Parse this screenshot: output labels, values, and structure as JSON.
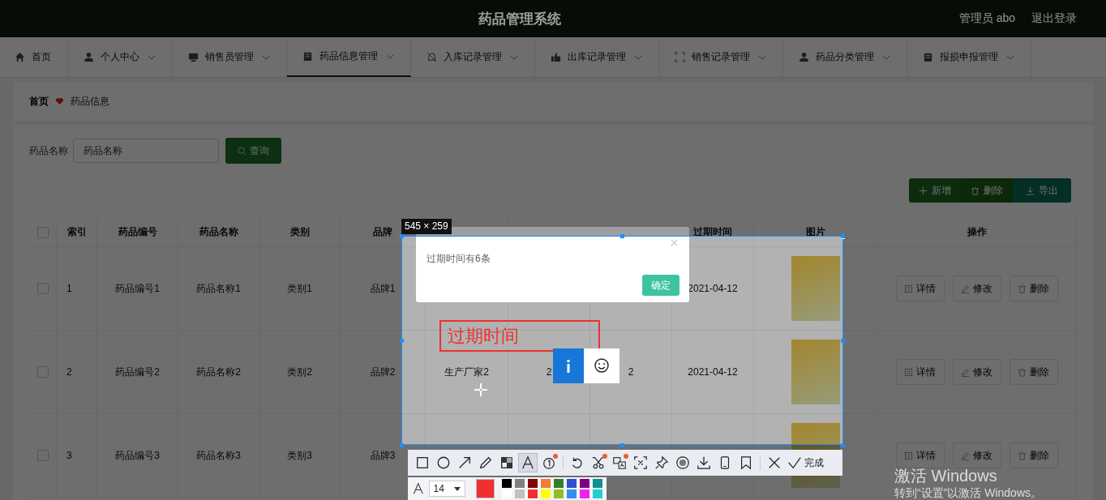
{
  "header": {
    "title": "药品管理系统",
    "user": "管理员 abo",
    "logout": "退出登录"
  },
  "nav": [
    {
      "label": "首页",
      "kind": "home",
      "dropdown": false,
      "selected": false
    },
    {
      "label": "个人中心",
      "kind": "user",
      "dropdown": true,
      "selected": false
    },
    {
      "label": "销售员管理",
      "kind": "monitor",
      "dropdown": true,
      "selected": false
    },
    {
      "label": "药品信息管理",
      "kind": "clipboard",
      "dropdown": true,
      "selected": true
    },
    {
      "label": "入库记录管理",
      "kind": "bell",
      "dropdown": true,
      "selected": false
    },
    {
      "label": "出库记录管理",
      "kind": "thumb",
      "dropdown": true,
      "selected": false
    },
    {
      "label": "销售记录管理",
      "kind": "frame",
      "dropdown": true,
      "selected": false
    },
    {
      "label": "药品分类管理",
      "kind": "user",
      "dropdown": true,
      "selected": false
    },
    {
      "label": "报损申报管理",
      "kind": "clipboard",
      "dropdown": true,
      "selected": false
    }
  ],
  "breadcrumb": {
    "home": "首页",
    "current": "药品信息"
  },
  "search": {
    "label": "药品名称",
    "placeholder": "药品名称",
    "button": "查询"
  },
  "actions": [
    {
      "label": "新增",
      "kind": "add"
    },
    {
      "label": "删除",
      "kind": "delete"
    },
    {
      "label": "导出",
      "kind": "export"
    }
  ],
  "table": {
    "header_checked": false,
    "columns": [
      {
        "kind": "text",
        "label": "索引"
      },
      {
        "kind": "text",
        "label": "药品编号"
      },
      {
        "kind": "text",
        "label": "药品名称"
      },
      {
        "kind": "text",
        "label": "类别"
      },
      {
        "kind": "text",
        "label": "品牌"
      },
      {
        "kind": "covered"
      },
      {
        "kind": "covered"
      },
      {
        "kind": "covered"
      },
      {
        "kind": "text",
        "label": "过期时间"
      },
      {
        "kind": "text",
        "label": "图片"
      },
      {
        "kind": "text",
        "label": "操作"
      }
    ],
    "rows": [
      {
        "checked": false,
        "cells": [
          "1",
          "药品编号1",
          "药品名称1",
          "类别1",
          "品牌1",
          null,
          null,
          null,
          "2021-04-12"
        ],
        "ops": [
          "详情",
          "修改",
          "删除"
        ]
      },
      {
        "checked": false,
        "cells": [
          "2",
          "药品编号2",
          "药品名称2",
          "类别2",
          "品牌2",
          "生产厂家2",
          "2",
          "2",
          "2021-04-12"
        ],
        "ops": [
          "详情",
          "修改",
          "删除"
        ]
      },
      {
        "checked": false,
        "cells": [
          "3",
          "药品编号3",
          "药品名称3",
          "类别3",
          "品牌3",
          null,
          null,
          null,
          null
        ],
        "ops": [
          "详情",
          "修改",
          "删除"
        ]
      }
    ]
  },
  "dialog": {
    "message": "过期时间有6条",
    "button": "确定"
  },
  "capture": {
    "size": "545 × 259",
    "annotation": "过期时间",
    "tools": [
      {
        "kind": "rect",
        "selected": false
      },
      {
        "kind": "ellipse",
        "selected": false
      },
      {
        "kind": "arrow",
        "selected": false
      },
      {
        "kind": "pencil",
        "selected": false
      },
      {
        "kind": "mosaic",
        "selected": false
      },
      {
        "kind": "text",
        "selected": true
      },
      {
        "kind": "number",
        "selected": false
      },
      {
        "kind": "sep"
      },
      {
        "kind": "undo",
        "selected": false
      },
      {
        "kind": "cut",
        "selected": false
      },
      {
        "kind": "translate",
        "selected": false
      },
      {
        "kind": "ocr",
        "selected": false
      },
      {
        "kind": "pin",
        "selected": false
      },
      {
        "kind": "record",
        "selected": false
      },
      {
        "kind": "download",
        "selected": false
      },
      {
        "kind": "phone",
        "selected": false
      },
      {
        "kind": "bookmark",
        "selected": false
      },
      {
        "kind": "sep"
      },
      {
        "kind": "close",
        "selected": false
      }
    ],
    "done": "完成",
    "font_size": "14",
    "palette": [
      {
        "color": "#000000",
        "selected": false
      },
      {
        "color": "#808080",
        "selected": false
      },
      {
        "color": "#800000",
        "selected": false
      },
      {
        "color": "#f08030",
        "selected": false
      },
      {
        "color": "#308030",
        "selected": false
      },
      {
        "color": "#3050d0",
        "selected": false
      },
      {
        "color": "#800080",
        "selected": false
      },
      {
        "color": "#109090",
        "selected": false
      },
      {
        "color": "#ffffff",
        "selected": false
      },
      {
        "color": "#c0c0c0",
        "selected": false
      },
      {
        "color": "#f03030",
        "selected": true
      },
      {
        "color": "#ffff00",
        "selected": false
      },
      {
        "color": "#90c020",
        "selected": false
      },
      {
        "color": "#3090f0",
        "selected": false
      },
      {
        "color": "#f020f0",
        "selected": false
      },
      {
        "color": "#20d0d0",
        "selected": false
      }
    ]
  },
  "windows": {
    "title": "激活 Windows",
    "hint": "转到“设置”以激活 Windows。"
  }
}
